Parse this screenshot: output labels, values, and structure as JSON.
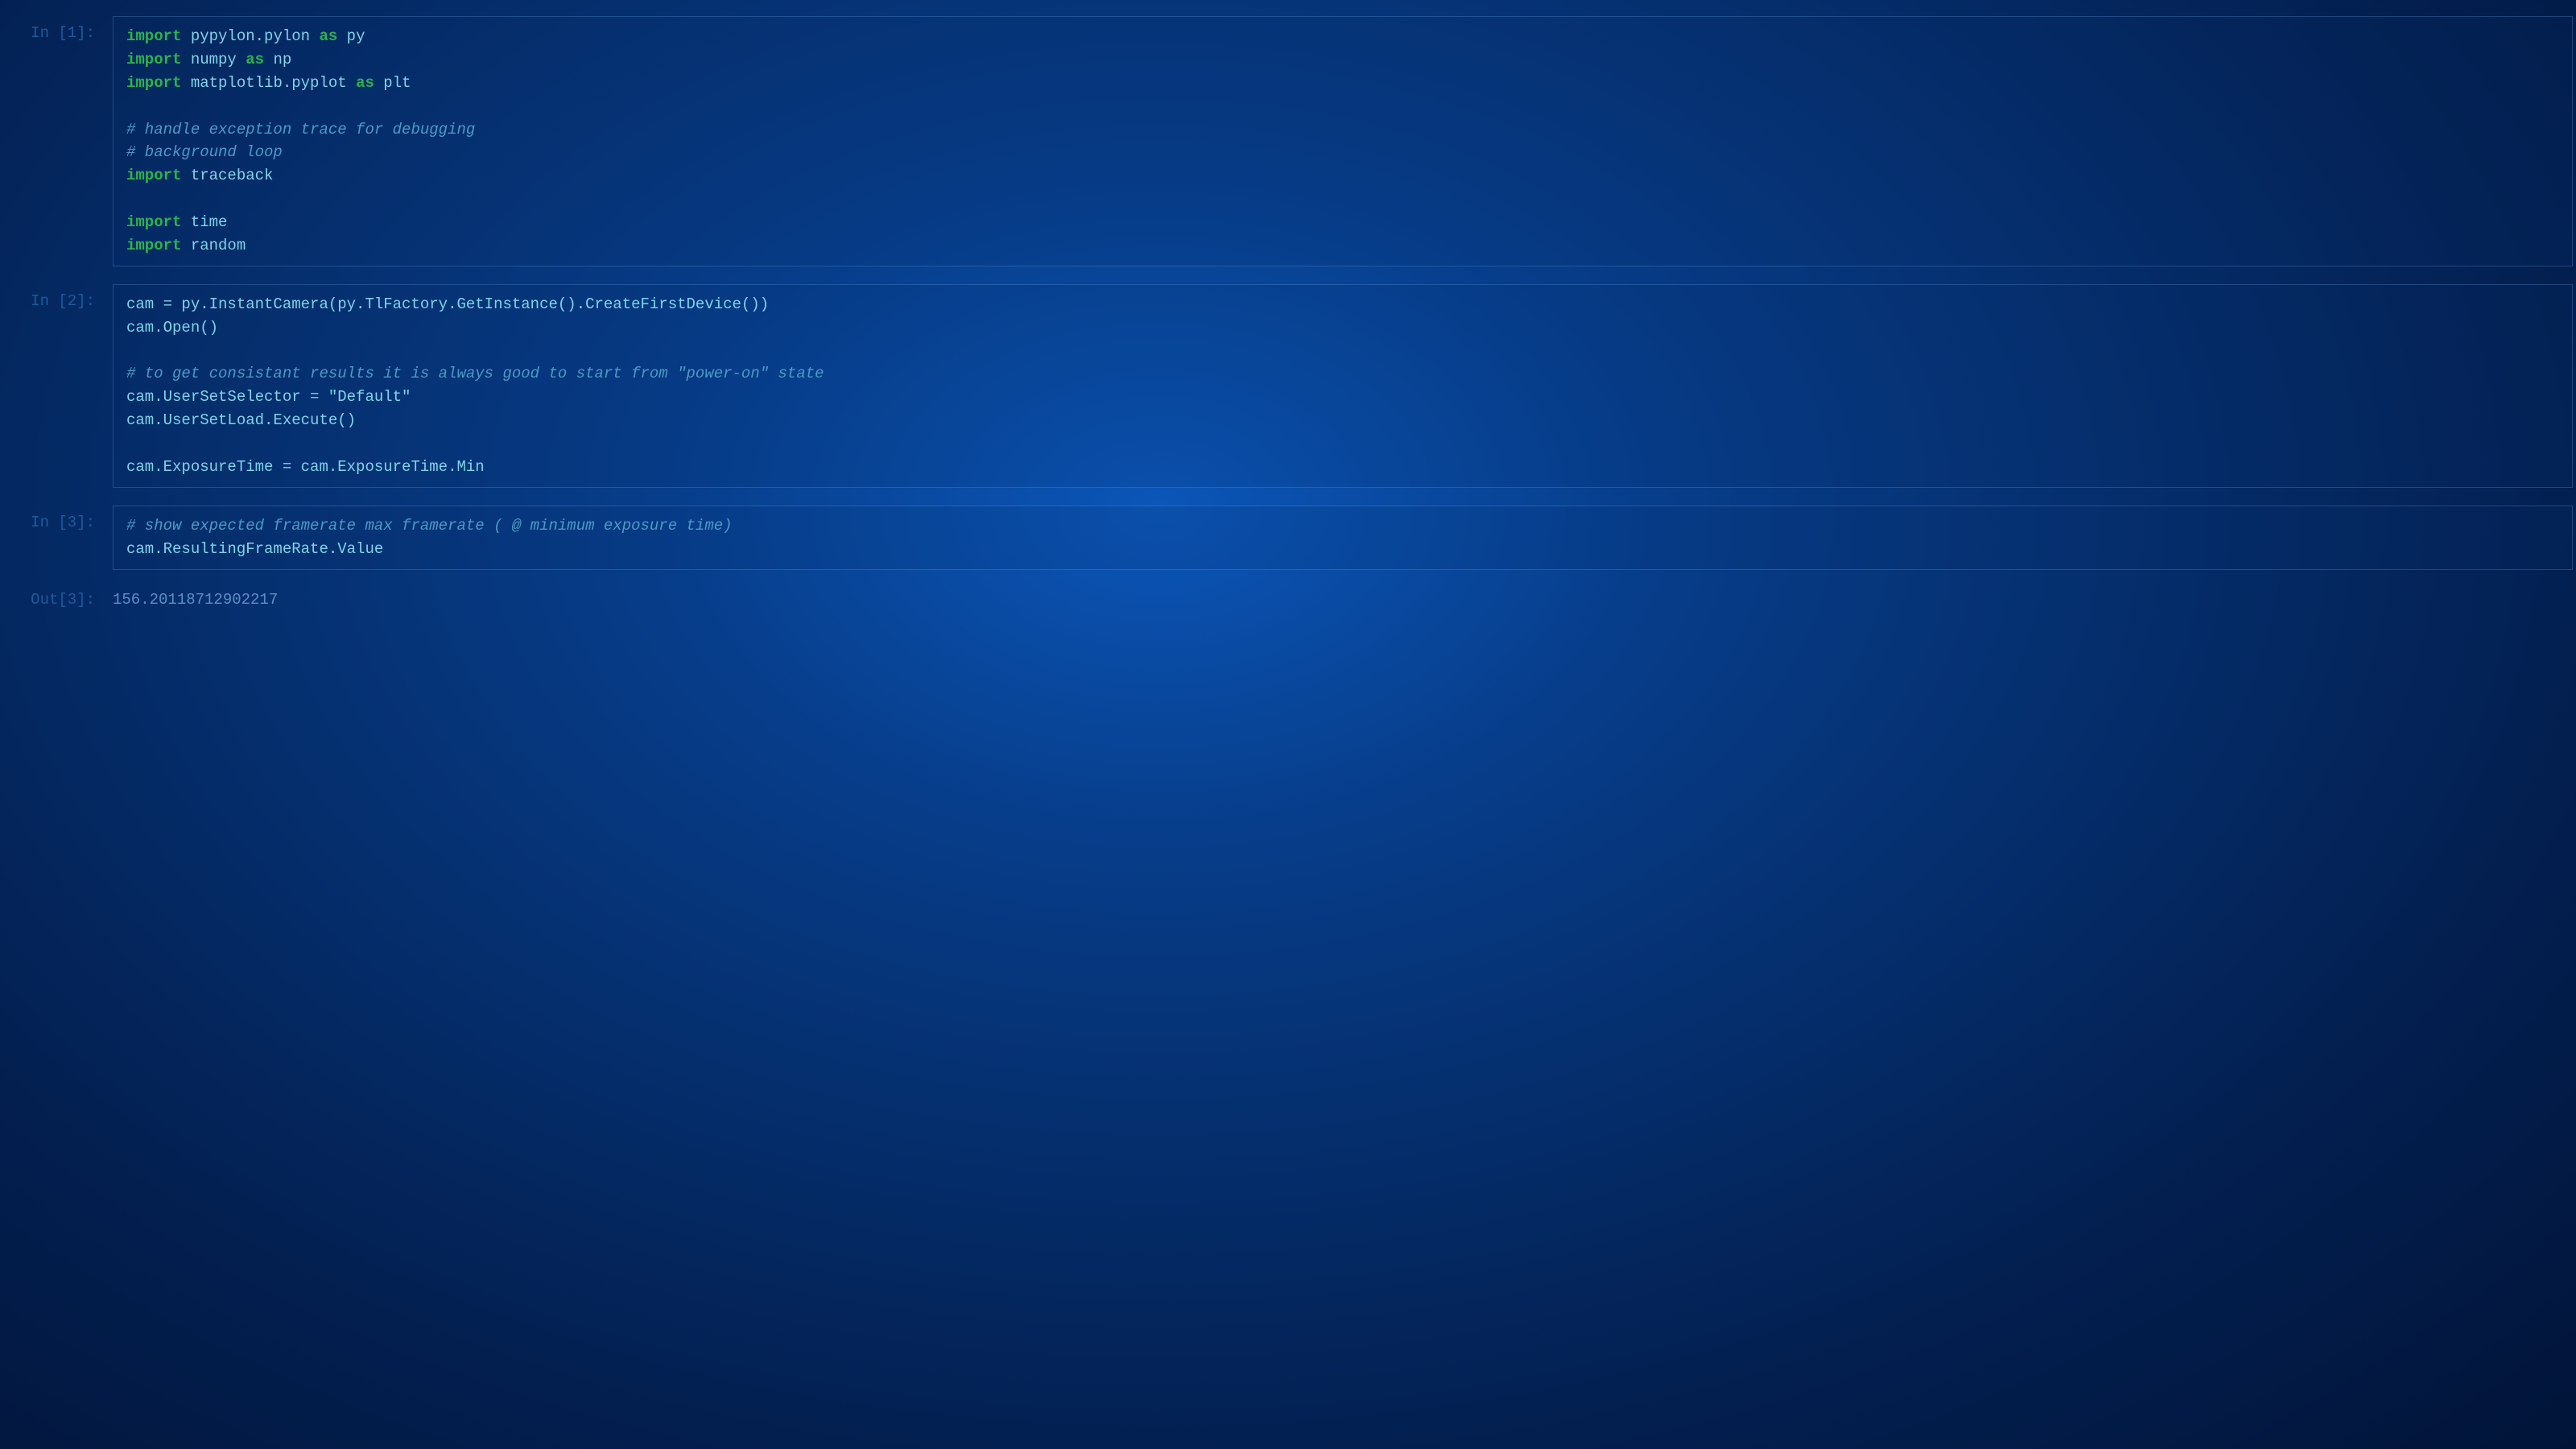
{
  "cells": [
    {
      "prompt": "In [1]:",
      "tokens": [
        {
          "t": "import",
          "c": "kw"
        },
        {
          "t": " pypylon.pylon ",
          "c": "plain"
        },
        {
          "t": "as",
          "c": "kw"
        },
        {
          "t": " py\n",
          "c": "plain"
        },
        {
          "t": "import",
          "c": "kw"
        },
        {
          "t": " numpy ",
          "c": "plain"
        },
        {
          "t": "as",
          "c": "kw"
        },
        {
          "t": " np\n",
          "c": "plain"
        },
        {
          "t": "import",
          "c": "kw"
        },
        {
          "t": " matplotlib.pyplot ",
          "c": "plain"
        },
        {
          "t": "as",
          "c": "kw"
        },
        {
          "t": " plt\n",
          "c": "plain"
        },
        {
          "t": "\n",
          "c": "plain"
        },
        {
          "t": "# handle exception trace for debugging\n",
          "c": "cm"
        },
        {
          "t": "# background loop\n",
          "c": "cm"
        },
        {
          "t": "import",
          "c": "kw"
        },
        {
          "t": " traceback\n",
          "c": "plain"
        },
        {
          "t": "\n",
          "c": "plain"
        },
        {
          "t": "import",
          "c": "kw"
        },
        {
          "t": " time\n",
          "c": "plain"
        },
        {
          "t": "import",
          "c": "kw"
        },
        {
          "t": " random",
          "c": "plain"
        }
      ]
    },
    {
      "prompt": "In [2]:",
      "tokens": [
        {
          "t": "cam = py.InstantCamera(py.TlFactory.GetInstance().CreateFirstDevice())\n",
          "c": "plain"
        },
        {
          "t": "cam.Open()\n",
          "c": "plain"
        },
        {
          "t": "\n",
          "c": "plain"
        },
        {
          "t": "# to get consistant results it is always good to start from \"power-on\" state\n",
          "c": "cm"
        },
        {
          "t": "cam.UserSetSelector = ",
          "c": "plain"
        },
        {
          "t": "\"Default\"",
          "c": "str"
        },
        {
          "t": "\n",
          "c": "plain"
        },
        {
          "t": "cam.UserSetLoad.Execute()\n",
          "c": "plain"
        },
        {
          "t": "\n",
          "c": "plain"
        },
        {
          "t": "cam.ExposureTime = cam.ExposureTime.Min",
          "c": "plain"
        }
      ]
    },
    {
      "prompt": "In [3]:",
      "tokens": [
        {
          "t": "# show expected framerate max framerate ( @ minimum exposure time)\n",
          "c": "cm"
        },
        {
          "t": "cam.ResultingFrameRate.Value",
          "c": "plain"
        }
      ]
    }
  ],
  "output": {
    "prompt": "Out[3]:",
    "value": "156.20118712902217"
  }
}
